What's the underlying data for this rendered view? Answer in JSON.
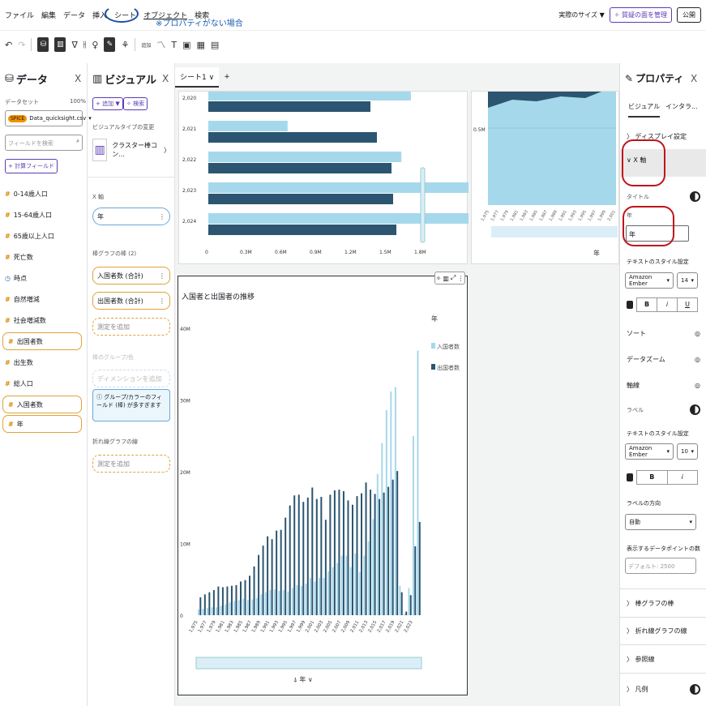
{
  "menu": {
    "items": [
      "ファイル",
      "編集",
      "データ",
      "挿入",
      "シート",
      "オブジェクト",
      "検索"
    ],
    "annotation": "※プロパティがない場合"
  },
  "topright": {
    "size": "実際のサイズ ▼",
    "manage": "✧ 質疑の面を管理",
    "publish": "公開"
  },
  "data_panel": {
    "title": "データ",
    "dataset_label": "データセット",
    "dataset_pct": "100%",
    "spice": "SPICE",
    "dataset_name": "Data_quicksight.csv",
    "search_placeholder": "フィールドを検索",
    "calc_field": "+ 計算フィールド",
    "fields": [
      {
        "icon": "#",
        "label": "0-14歳人口",
        "used": false
      },
      {
        "icon": "#",
        "label": "15-64歳人口",
        "used": false
      },
      {
        "icon": "#",
        "label": "65歳以上人口",
        "used": false
      },
      {
        "icon": "#",
        "label": "死亡数",
        "used": false
      },
      {
        "icon": "◷",
        "label": "時点",
        "used": false
      },
      {
        "icon": "#",
        "label": "自然増減",
        "used": false
      },
      {
        "icon": "#",
        "label": "社会増減数",
        "used": false
      },
      {
        "icon": "#",
        "label": "出国者数",
        "used": true
      },
      {
        "icon": "#",
        "label": "出生数",
        "used": false
      },
      {
        "icon": "#",
        "label": "総人口",
        "used": false
      },
      {
        "icon": "#",
        "label": "入国者数",
        "used": true
      },
      {
        "icon": "#",
        "label": "年",
        "used": true
      }
    ]
  },
  "visual_panel": {
    "title": "ビジュアル",
    "add": "+ 追加 ▼",
    "search_btn": "✧ 検索",
    "change_type": "ビジュアルタイプの変更",
    "type_name": "クラスター棒コン...",
    "xaxis_label": "X 軸",
    "xaxis_value": "年",
    "bars_label": "棒グラフの棒 (2)",
    "bar1": "入国者数 (合計)",
    "bar2": "出国者数 (合計)",
    "add_measure": "測定を追加",
    "group_label": "棒のグループ/色",
    "add_dim": "ディメンションを追加",
    "group_note": "グループ/カラーのフィールド (棒) が多すぎます",
    "lines_label": "折れ線グラフの線",
    "add_measure2": "測定を追加"
  },
  "canvas": {
    "tab": "シート1",
    "plus": "+",
    "top_chart": {
      "years": [
        "2,020",
        "2,021",
        "2,022",
        "2,023",
        "2,024"
      ],
      "xticks": [
        "0",
        "0.3M",
        "0.6M",
        "0.9M",
        "1.2M",
        "1.5M",
        "1.8M"
      ]
    },
    "area_chart": {
      "tick": "0.5M",
      "xlabel": "年"
    },
    "main_title": "入国者と出国者の推移",
    "legend_title": "年",
    "legend_in": "入国者数",
    "legend_out": "出国者数",
    "yticks": [
      "0",
      "10M",
      "20M",
      "30M",
      "40M"
    ],
    "xaxis": "年"
  },
  "colors": {
    "in": "#a6d8ec",
    "out": "#2b5570"
  },
  "chart_data": {
    "type": "bar",
    "ylim": [
      0,
      40000000
    ],
    "years": [
      1975,
      1976,
      1977,
      1978,
      1979,
      1980,
      1981,
      1982,
      1983,
      1984,
      1985,
      1986,
      1987,
      1988,
      1989,
      1990,
      1991,
      1992,
      1993,
      1994,
      1995,
      1996,
      1997,
      1998,
      1999,
      2000,
      2001,
      2002,
      2003,
      2004,
      2005,
      2006,
      2007,
      2008,
      2009,
      2010,
      2011,
      2012,
      2013,
      2014,
      2015,
      2016,
      2017,
      2018,
      2019,
      2020,
      2021,
      2022,
      2023,
      2024
    ],
    "series": [
      {
        "name": "入国者数",
        "values": [
          800000,
          900000,
          1000000,
          1100000,
          1100000,
          1300000,
          1500000,
          1800000,
          2000000,
          2100000,
          2300000,
          2100000,
          2200000,
          2400000,
          2900000,
          3200000,
          3500000,
          3600000,
          3400000,
          3500000,
          3300000,
          3800000,
          4200000,
          4100000,
          4400000,
          5200000,
          4700000,
          5200000,
          5200000,
          6100000,
          6700000,
          7300000,
          8300000,
          8300000,
          6700000,
          8600000,
          6000000,
          8300000,
          10300000,
          13400000,
          19700000,
          24000000,
          28600000,
          31200000,
          31800000,
          4100000,
          200000,
          3800000,
          25000000,
          36900000
        ]
      },
      {
        "name": "出国者数",
        "values": [
          2500000,
          2900000,
          3200000,
          3500000,
          4000000,
          3900000,
          4000000,
          4100000,
          4200000,
          4700000,
          4900000,
          5500000,
          6800000,
          8400000,
          9700000,
          11000000,
          10600000,
          11800000,
          11900000,
          13600000,
          15300000,
          16700000,
          16800000,
          15800000,
          16400000,
          17800000,
          16200000,
          16500000,
          13300000,
          16800000,
          17400000,
          17500000,
          17300000,
          16000000,
          15400000,
          16600000,
          17000000,
          18500000,
          17500000,
          16900000,
          16200000,
          17100000,
          17900000,
          18900000,
          20100000,
          3200000,
          500000,
          2800000,
          9600000,
          13000000
        ]
      }
    ]
  },
  "prop_panel": {
    "title": "プロパティ",
    "tab1": "ビジュアル",
    "tab2": "インタラ...",
    "display": "ディスプレイ設定",
    "xaxis": "X 軸",
    "title_lbl": "タイトル",
    "year_lbl": "年",
    "year_val": "年",
    "text_style": "テキストのスタイル設定",
    "font": "Amazon Ember",
    "size": "14",
    "bold": "B",
    "italic": "i",
    "underline": "U",
    "sort": "ソート",
    "zoom": "データズーム",
    "axis_line": "軸線",
    "label": "ラベル",
    "text_style2": "テキストのスタイル設定",
    "font2": "Amazon Ember",
    "size2": "10",
    "bold2": "B",
    "italic2": "i",
    "label_dir": "ラベルの方向",
    "label_dir_val": "自動",
    "points": "表示するデータポイントの数",
    "points_ph": "デフォルト: 2500",
    "sec_bars": "棒グラフの棒",
    "sec_lines": "折れ線グラフの線",
    "sec_ref": "参照線",
    "sec_legend": "凡例"
  }
}
